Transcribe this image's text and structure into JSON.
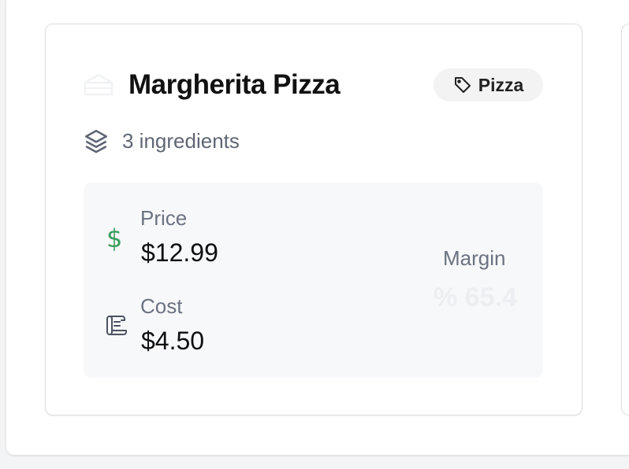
{
  "product": {
    "name": "Margherita Pizza",
    "category": "Pizza",
    "ingredients_text": "3 ingredients",
    "price_label": "Price",
    "price_value": "$12.99",
    "cost_label": "Cost",
    "cost_value": "$4.50",
    "margin_label": "Margin",
    "margin_value": "% 65.4"
  },
  "icons": {
    "title": "pizza-slice-icon",
    "category": "tag-icon",
    "ingredients": "layers-icon",
    "price": "dollar-icon",
    "cost": "receipt-icon"
  },
  "colors": {
    "price_icon": "#3a9d5d",
    "stats_background": "#f7f8fa",
    "tag_background": "#f3f3f3"
  }
}
